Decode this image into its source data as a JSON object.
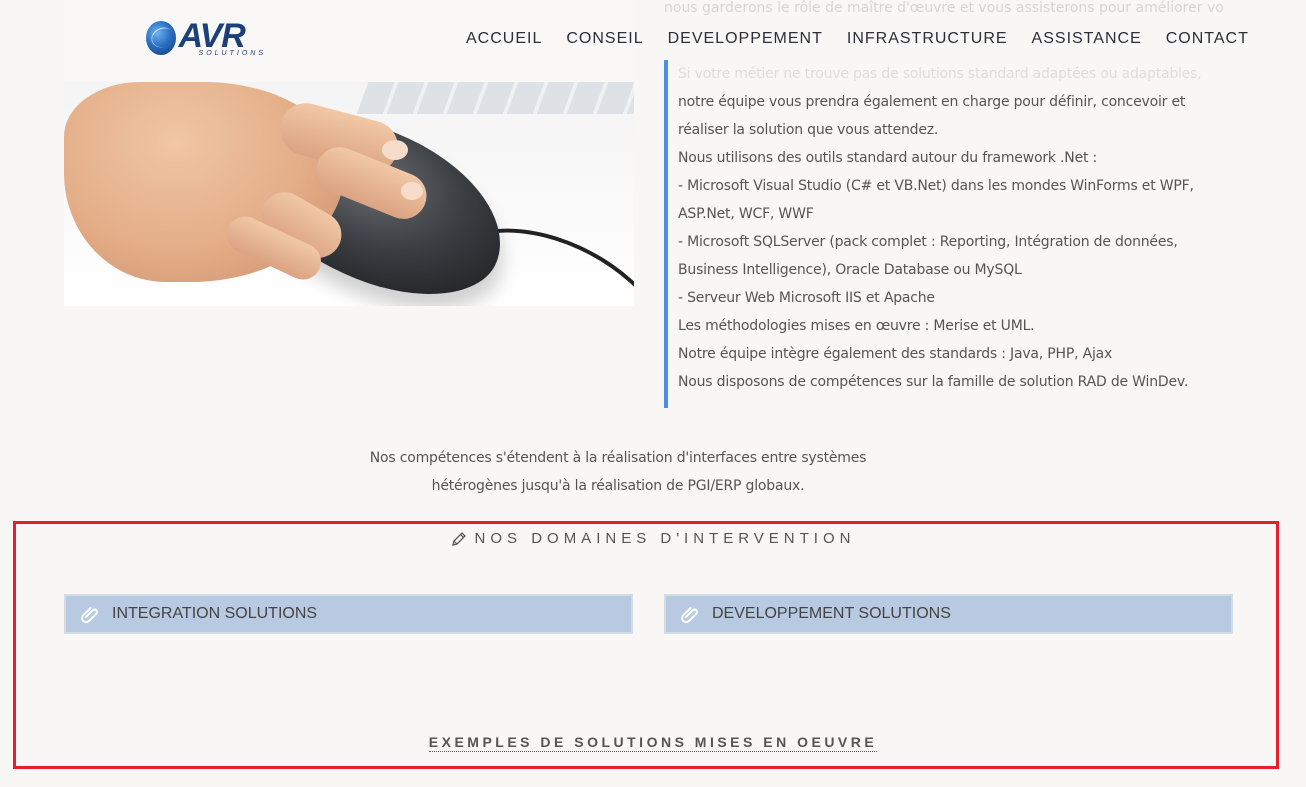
{
  "header": {
    "logo": {
      "word": "AVR",
      "sub": "SOLUTIONS"
    },
    "nav": [
      "ACCUEIL",
      "CONSEIL",
      "DEVELOPPEMENT",
      "INFRASTRUCTURE",
      "ASSISTANCE",
      "CONTACT"
    ]
  },
  "intro_faded": "nous garderons le rôle de maître d'œuvre et vous assisterons pour améliorer vos",
  "description": {
    "faded_line": "Si votre métier ne trouve pas de solutions standard adaptées ou adaptables,",
    "lines": [
      "notre équipe vous prendra également en charge pour définir, concevoir et",
      "réaliser la solution que vous attendez.",
      "Nous utilisons des outils standard autour du framework .Net :",
      "- Microsoft Visual Studio (C# et VB.Net) dans les mondes WinForms et WPF,",
      "ASP.Net, WCF, WWF",
      "- Microsoft SQLServer (pack complet : Reporting, Intégration de données,",
      "Business Intelligence), Oracle Database ou MySQL",
      "- Serveur Web Microsoft IIS et Apache",
      "Les méthodologies mises en œuvre : Merise et UML.",
      "Notre équipe intègre également des standards : Java, PHP, Ajax",
      "Nous disposons de compétences sur la famille de solution RAD de WinDev."
    ]
  },
  "competences": {
    "line1": "Nos compétences s'étendent à la réalisation d'interfaces entre systèmes",
    "line2": "hétérogènes jusqu'à la réalisation de PGI/ERP globaux."
  },
  "domains": {
    "title": "NOS DOMAINES D'INTERVENTION",
    "title_icon": "pencil-icon",
    "items": [
      {
        "label": "INTEGRATION SOLUTIONS",
        "icon": "paperclip-icon"
      },
      {
        "label": "DEVELOPPEMENT SOLUTIONS",
        "icon": "paperclip-icon"
      }
    ],
    "examples_link": "EXEMPLES DE SOLUTIONS MISES EN OEUVRE"
  },
  "colors": {
    "accent_border": "#4a90e2",
    "domain_button_bg": "#b7cae1",
    "highlight_frame": "#e41e2b",
    "brand": "#1d3f7a"
  }
}
